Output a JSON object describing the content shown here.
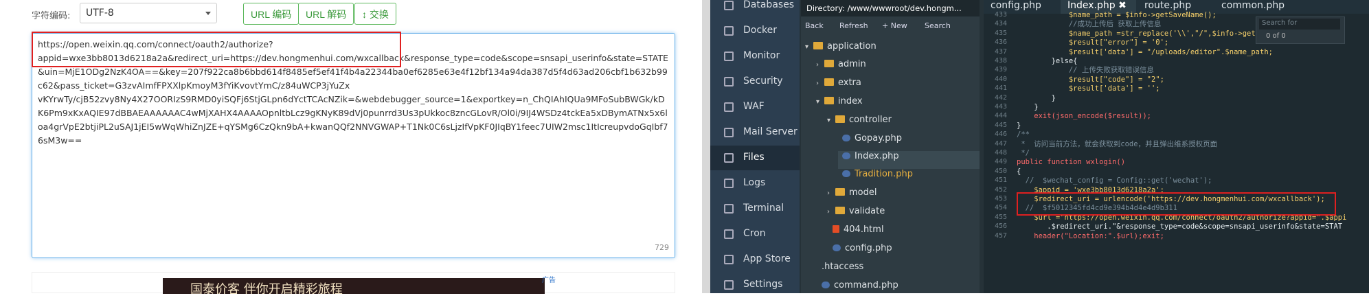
{
  "left": {
    "encoding_label": "字符编码:",
    "encoding_value": "UTF-8",
    "buttons": [
      "URL 编码",
      "URL 解码",
      "↕ 交换"
    ],
    "textarea": "https://open.weixin.qq.com/connect/oauth2/authorize?\nappid=wxe3bb8013d6218a2a&redirect_uri=https://dev.hongmenhui.com/wxcallback&response_type=code&scope=snsapi_userinfo&state=STATE&uin=MjE1ODg2NzK4OA==&key=207f922ca8b6bbd614f8485ef5ef41f4b4a22344ba0ef6285e63e4f12bf134a94da387d5f4d63ad206cbf1b632b99c62&pass_ticket=G3zvAImfFPXXlpKmoyM3fYiKvovtYmC/z84uWCP3jYuZx\nvKYrwTy/cjB52zvy8Ny4X27OORIzS9RMD0yiSQFj6StjGLpn6dYctTCAcNZik=&webdebugger_source=1&exportkey=n_ChQIAhIQUa9MFoSubBWGk/kDK6Pm9xKxAQIE97dBBAEAAAAAAC4wMjXAHX4AAAAOpnltbLcz9gKNyK89dVj0punrrd3Us3pUkkoc8zncGLovR/Ol0i/9IJ4WSDz4tckEa5xDBymATNx5x6loa4grVpE2btjiPL2uSAJ1jEI5wWqWhiZnJZE+qYSMg6CzQkn9bA+kwanQQf2NNVGWAP+T1Nk0C6sLjzIfVpKF0JIqBY1feec7UIW2msc1ItIcreupvdoGqIbf76sM3w==",
    "counter": "729",
    "ad_text": "国泰价客 伴你开启精彩旅程",
    "ad_tag": "广告"
  },
  "nav": [
    "Databases",
    "Docker",
    "Monitor",
    "Security",
    "WAF",
    "Mail Server",
    "Files",
    "Logs",
    "Terminal",
    "Cron",
    "App Store",
    "Settings"
  ],
  "files": {
    "directory": "Directory: /www/wwwroot/dev.hongm...",
    "toolbar": [
      "Back",
      "Refresh",
      "+ New",
      "Search"
    ],
    "tree": [
      "application",
      "admin",
      "extra",
      "index",
      "controller",
      "Gopay.php",
      "Index.php",
      "Tradition.php",
      "model",
      "validate",
      "404.html",
      "config.php",
      ".htaccess",
      "command.php"
    ]
  },
  "editor": {
    "tabs": [
      "config.php",
      "Index.php",
      "route.php",
      "common.php"
    ],
    "search_placeholder": "Search for",
    "search_count": "0 of 0",
    "lines": [
      "433",
      "434",
      "435",
      "436",
      "437",
      "438",
      "439",
      "440",
      "441",
      "442",
      "443",
      "444",
      "445",
      "446",
      "447",
      "448",
      "449",
      "450",
      "451",
      "452",
      "453",
      "454",
      "455",
      "456",
      "457"
    ]
  },
  "code": [
    "            $name_path = $info->getSaveName();",
    "            //成功上传后 获取上传信息",
    "            $name_path =str_replace('\\\\',\"/\",$info->getSav",
    "            $result[\"error\"] = '0';",
    "            $result['data'] = \"/uploads/editor\".$name_path;",
    "        }else{",
    "            // 上传失败获取错误信息",
    "            $result[\"code\"] = \"2\";",
    "            $result['data'] = '';",
    "        }",
    "    }",
    "    exit(json_encode($result));",
    "}",
    "/**",
    " *  访问当前方法，就会获取到code，并且弹出维系授权页面",
    " */",
    "public function wxlogin()",
    "{",
    "  //  $wechat_config = Config::get('wechat');",
    "    $appid = 'wxe3bb8013d6218a2a';",
    "    $redirect_uri = urlencode('https://dev.hongmenhui.com/wxcallback');",
    "  //  $f5012345fd4cd9e394b4d4e4d9b311",
    "    $url =\"https://open.weixin.qq.com/connect/oauth2/authorize?appid=\".$appi",
    "       .$redirect_uri.\"&response_type=code&scope=snsapi_userinfo&state=STAT",
    "    header(\"Location:\".$url);exit;"
  ]
}
